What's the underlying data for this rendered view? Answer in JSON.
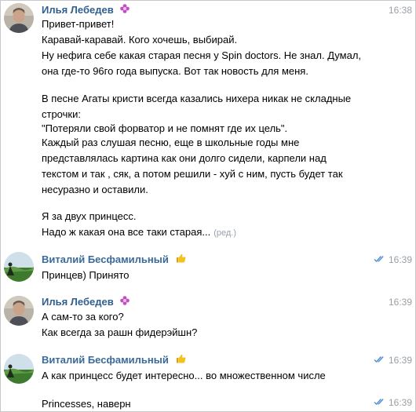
{
  "colors": {
    "name_ilya": "#2f5f8e",
    "name_vitaliy": "#3a6a99",
    "time": "#9aa0a6",
    "checks": "#4f8fcf",
    "text": "#000000"
  },
  "messages": [
    {
      "author": "Илья Лебедев",
      "author_color": "#2f5f8e",
      "badge_icon": "flower-badge-icon",
      "time": "16:38",
      "read": false,
      "lines": [
        "Привет-привет!",
        "Каравай-каравай. Кого хочешь, выбирай.",
        "Ну нефига себе какая старая песня у Spin doctors. Не знал. Думал,",
        "она где-то 96го года выпуска. Вот так новость для меня.",
        "",
        "В песне Агаты кристи всегда казались нихера никак не складные",
        "строчки:",
        "\"Потеряли свой форватор и не помнят где их цель\".",
        "Каждый раз слушая песню, еще в школьные годы мне",
        "представлялась картина как они долго сидели, карпели над",
        "текстом и так , сяк, а потом решили - хуй с ним, пусть будет так",
        "несуразно и оставили.",
        "",
        "Я за двух принцесс.",
        "Надо ж какая она все таки старая..."
      ],
      "edited_label": "(ред.)"
    },
    {
      "author": "Виталий Бесфамильный",
      "author_color": "#3a6a99",
      "badge_icon": "thumbs-up-icon",
      "time": "16:39",
      "read": true,
      "lines": [
        "Принцев) Принято"
      ]
    },
    {
      "author": "Илья Лебедев",
      "author_color": "#2f5f8e",
      "badge_icon": "flower-badge-icon",
      "time": "16:39",
      "read": false,
      "lines": [
        "А сам-то за кого?",
        "Как всегда за рашн фидерэйшн?"
      ]
    },
    {
      "author": "Виталий Бесфамильный",
      "author_color": "#3a6a99",
      "badge_icon": "thumbs-up-icon",
      "time": "16:39",
      "read": true,
      "lines": [
        "А как принцесс будет интересно... во множественном числе"
      ]
    },
    {
      "author": "",
      "time": "16:39",
      "read": true,
      "lines": [
        "Princesses, наверн"
      ]
    }
  ]
}
